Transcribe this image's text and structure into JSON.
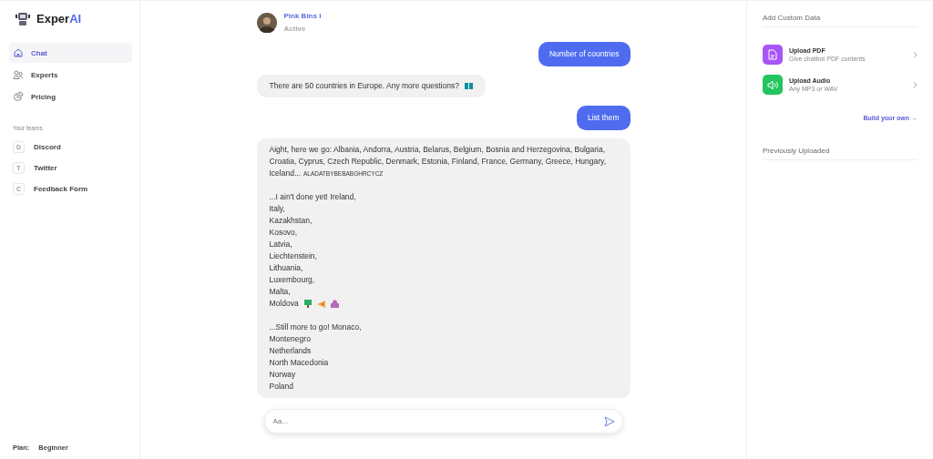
{
  "brand": {
    "name": "Exper",
    "accent": "AI"
  },
  "nav": [
    {
      "label": "Chat",
      "selected": true
    },
    {
      "label": "Experts",
      "selected": false
    },
    {
      "label": "Pricing",
      "selected": false
    }
  ],
  "teams": {
    "heading": "Your teams",
    "items": [
      {
        "initial": "D",
        "label": "Discord"
      },
      {
        "initial": "T",
        "label": "Twitter"
      },
      {
        "initial": "C",
        "label": "Feedback Form"
      }
    ]
  },
  "plan": {
    "label": "Plan:",
    "value": "Beginner"
  },
  "contact": {
    "name": "Pink Bins I",
    "status": "Active"
  },
  "messages": [
    {
      "kind": "user",
      "blocks": [
        [
          "Number of countries"
        ]
      ]
    },
    {
      "kind": "bot",
      "blocks": [
        [
          "There are 50 countries in Europe. Any more questions?"
        ]
      ]
    },
    {
      "kind": "user",
      "blocks": [
        [
          "List them"
        ]
      ]
    },
    {
      "kind": "bot",
      "tag": "ALADATBYBEBABGHRCYCZ",
      "blocks": [
        [
          "Aight, here we go: Albania, Andorra, Austria, Belarus, Belgium, Bosnia and Herzegovina, Bulgaria, Croatia, Cyprus, Czech Republic, Denmark, Estonia, Finland, France, Germany, Greece, Hungary, Iceland..."
        ],
        [
          "...I ain't done yet! Ireland,",
          "Italy,",
          "Kazakhstan,",
          "Kosovo,",
          "Latvia,",
          "Liechtenstein,",
          "Lithuania,",
          "Luxembourg,",
          "Malta,",
          "Moldova"
        ],
        [
          "...Still more to go! Monaco,",
          "Montenegro",
          "Netherlands",
          "North Macedonia",
          "Norway",
          "Poland"
        ]
      ]
    }
  ],
  "composer": {
    "placeholder": "Aa..."
  },
  "panel": {
    "heading": "Add Custom Data",
    "uploads": [
      {
        "kind": "pdf",
        "title": "Upload PDF",
        "subtitle": "Give chatbot PDF contents",
        "color": "#a855f7"
      },
      {
        "kind": "audio",
        "title": "Upload Audio",
        "subtitle": "Any MP3 or WAV",
        "color": "#22c55e"
      }
    ],
    "link": "Build your own →",
    "previous": "Previously Uploaded"
  }
}
